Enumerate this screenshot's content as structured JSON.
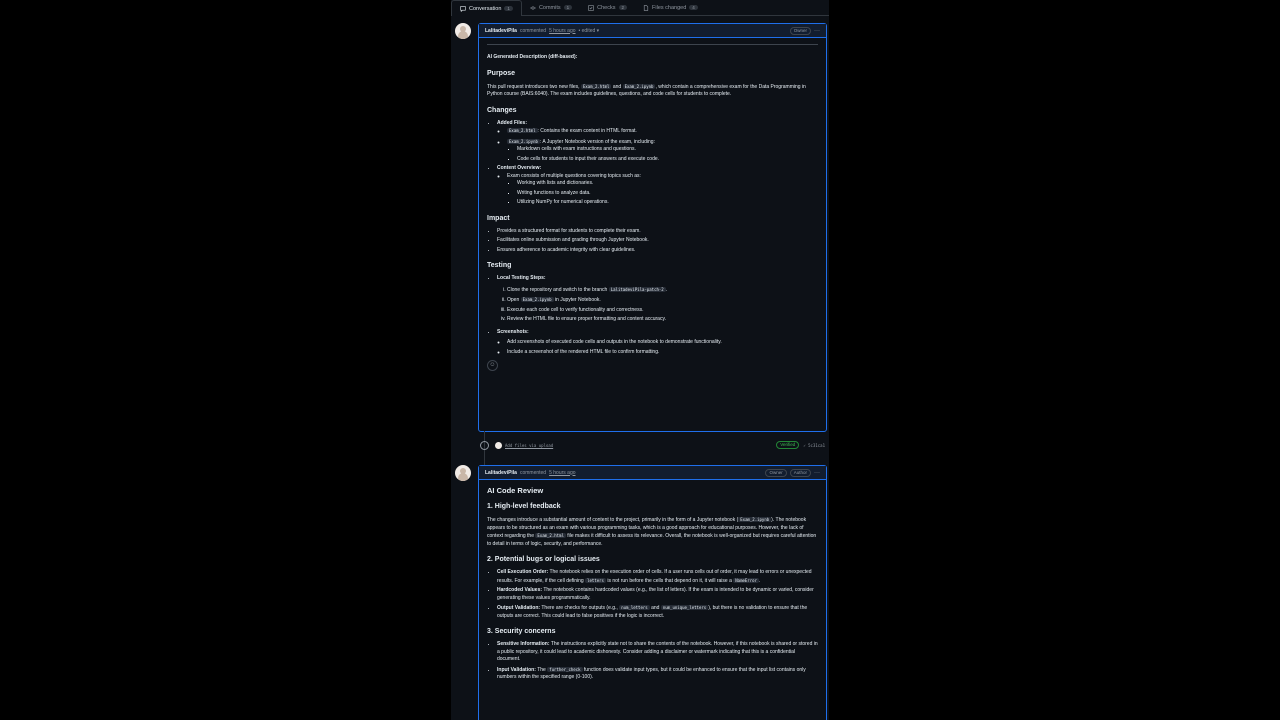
{
  "tabs": [
    {
      "label": "Conversation",
      "count": "1",
      "icon": "comment-icon"
    },
    {
      "label": "Commits",
      "count": "1",
      "icon": "commit-icon"
    },
    {
      "label": "Checks",
      "count": "2",
      "icon": "checklist-icon"
    },
    {
      "label": "Files changed",
      "count": "4",
      "icon": "file-diff-icon"
    }
  ],
  "comment1": {
    "author": "LalitadeviPila",
    "action": "commented",
    "ago": "5 hours ago",
    "edited": "• edited ▾",
    "badge_owner": "Owner",
    "title": "AI Generated Description (diff-based):",
    "purpose_h": "Purpose",
    "purpose_1": "This pull request introduces two new files,",
    "purpose_code1": "Exam_2.html",
    "purpose_and": "and",
    "purpose_code2": "Exam_2.ipynb",
    "purpose_2": ", which contain a comprehensive exam for the Data Programming in Python course (BAIS:6040). The exam includes guidelines, questions, and code cells for students to complete.",
    "changes_h": "Changes",
    "added_files": "Added Files:",
    "file1_code": "Exam_2.html",
    "file1_text": ": Contains the exam content in HTML format.",
    "file2_code": "Exam_2.ipynb",
    "file2_text": ": A Jupyter Notebook version of the exam, including:",
    "file2_sub1": "Markdown cells with exam instructions and questions.",
    "file2_sub2": "Code cells for students to input their answers and execute code.",
    "content_overview": "Content Overview:",
    "overview_1": "Exam consists of multiple questions covering topics such as:",
    "topic_1": "Working with lists and dictionaries.",
    "topic_2": "Writing functions to analyze data.",
    "topic_3": "Utilizing NumPy for numerical operations.",
    "impact_h": "Impact",
    "impact_1": "Provides a structured format for students to complete their exam.",
    "impact_2": "Facilitates online submission and grading through Jupyter Notebook.",
    "impact_3": "Ensures adherence to academic integrity with clear guidelines.",
    "testing_h": "Testing",
    "local_steps": "Local Testing Steps:",
    "step_1a": "Clone the repository and switch to the branch",
    "step_1code": "LalitadeviPila-patch-2",
    "step_1b": ".",
    "step_2a": "Open",
    "step_2code": "Exam_2.ipynb",
    "step_2b": "in Jupyter Notebook.",
    "step_3": "Execute each code cell to verify functionality and correctness.",
    "step_4": "Review the HTML file to ensure proper formatting and content accuracy.",
    "screenshots": "Screenshots:",
    "shot_1": "Add screenshots of executed code cells and outputs in the notebook to demonstrate functionality.",
    "shot_2": "Include a screenshot of the rendered HTML file to confirm formatting."
  },
  "commit": {
    "message": "Add files via upload",
    "verified": "Verified",
    "sha": "✓ 5c31ca1"
  },
  "comment2": {
    "author": "LalitadeviPila",
    "action": "commented",
    "ago": "5 hours ago",
    "badge_owner": "Owner",
    "badge_author": "Author",
    "title": "AI Code Review",
    "h1": "1. High-level feedback",
    "p1a": "The changes introduce a substantial amount of content to the project, primarily in the form of a Jupyter notebook (",
    "p1code1": "Exam_2.ipynb",
    "p1b": "). The notebook appears to be structured as an exam with various programming tasks, which is a good approach for educational purposes. However, the lack of context regarding the",
    "p1code2": "Exam_2.html",
    "p1c": "file makes it difficult to assess its relevance. Overall, the notebook is well-organized but requires careful attention to detail in terms of logic, security, and performance.",
    "h2": "2. Potential bugs or logical issues",
    "b1_label": "Cell Execution Order:",
    "b1a": "The notebook relies on the execution order of cells. If a user runs cells out of order, it may lead to errors or unexpected results. For example, if the cell defining",
    "b1code": "letters",
    "b1b": "is not run before the cells that depend on it, it will raise a",
    "b1code2": "NameError",
    "b1c": ".",
    "b2_label": "Hardcoded Values:",
    "b2": "The notebook contains hardcoded values (e.g., the list of letters). If the exam is intended to be dynamic or varied, consider generating these values programmatically.",
    "b3_label": "Output Validation:",
    "b3a": "There are checks for outputs (e.g.,",
    "b3code1": "num_letters",
    "b3and": "and",
    "b3code2": "num_unique_letters",
    "b3b": "), but there is no validation to ensure that the outputs are correct. This could lead to false positives if the logic is incorrect.",
    "h3": "3. Security concerns",
    "s1_label": "Sensitive Information:",
    "s1": "The instructions explicitly state not to share the contents of the notebook. However, if this notebook is shared or stored in a public repository, it could lead to academic dishonesty. Consider adding a disclaimer or watermark indicating that this is a confidential document.",
    "s2_label": "Input Validation:",
    "s2a": "The",
    "s2code": "further_check",
    "s2b": "function does validate input types, but it could be enhanced to ensure that the input list contains only numbers within the specified range (0-100)."
  }
}
